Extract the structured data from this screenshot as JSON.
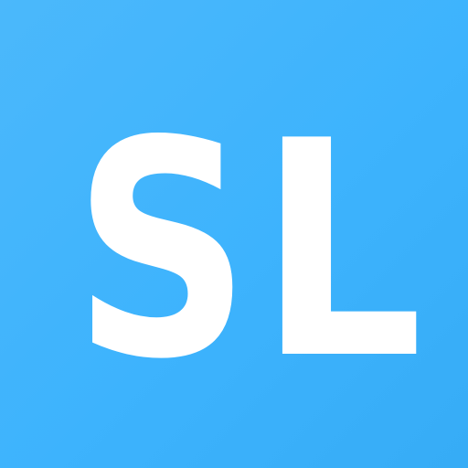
{
  "icon": {
    "letter_s": "S",
    "letter_l": "L",
    "background_color": "#3db3fd",
    "foreground_color": "#ffffff"
  }
}
